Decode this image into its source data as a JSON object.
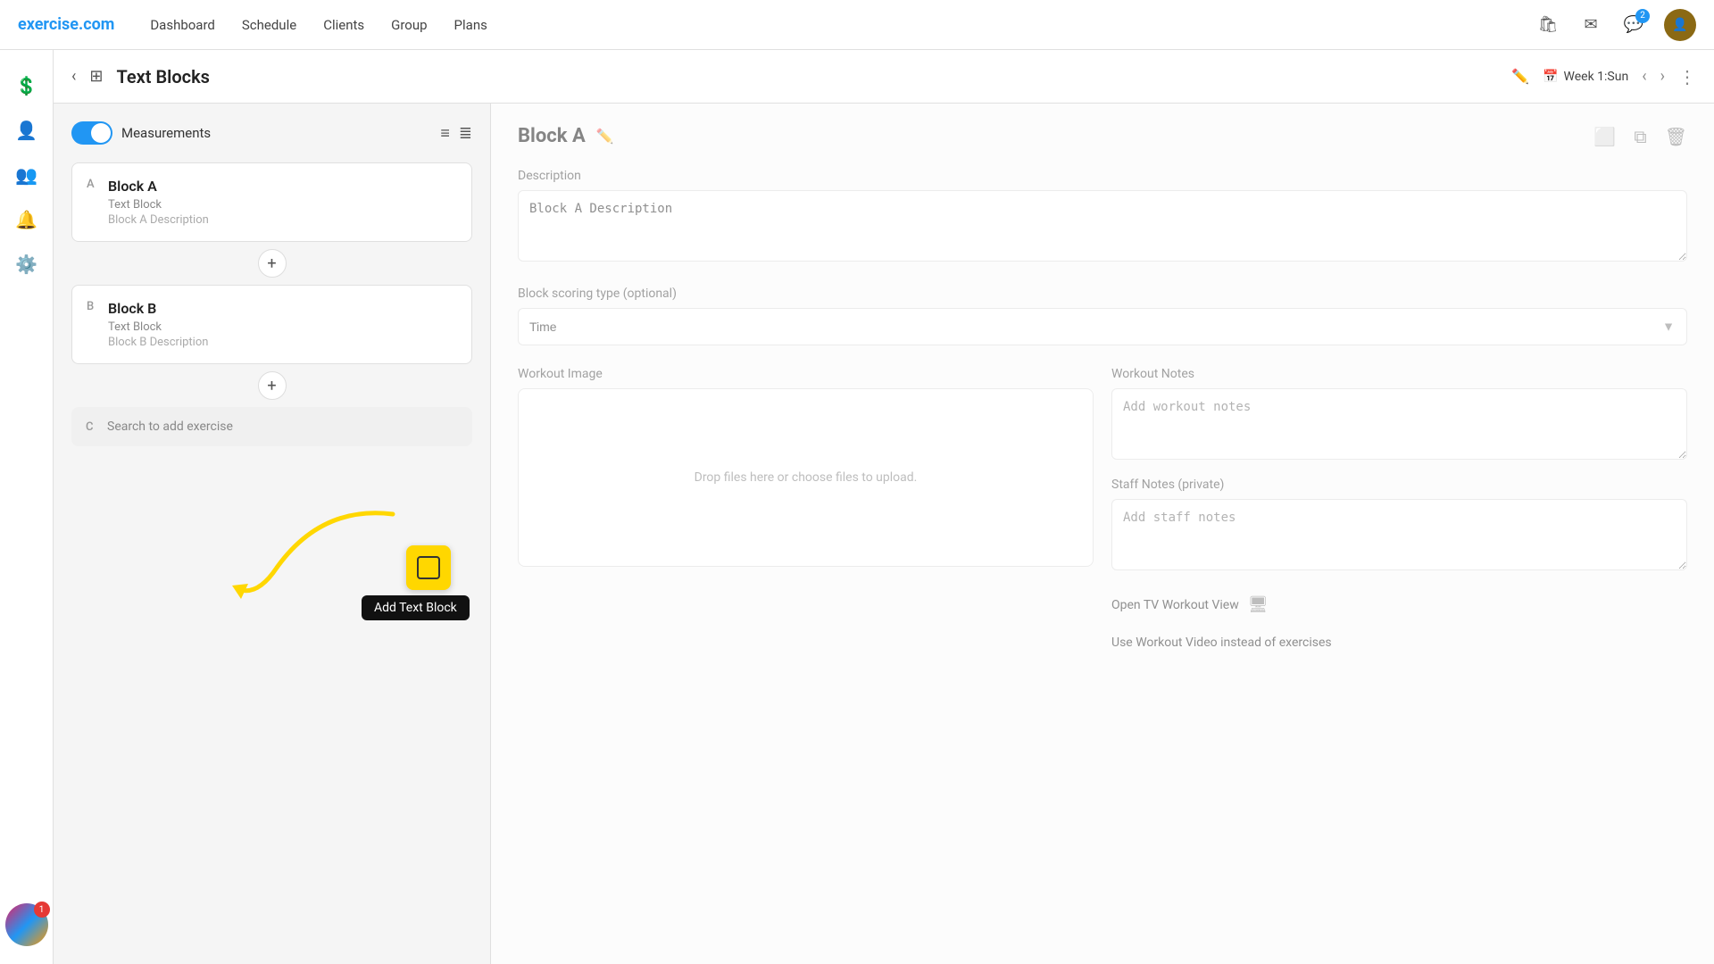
{
  "nav": {
    "logo_text": "exercise",
    "logo_dot": ".com",
    "links": [
      "Dashboard",
      "Schedule",
      "Clients",
      "Group",
      "Plans"
    ],
    "notification_badge": "2"
  },
  "sub_header": {
    "title": "Text Blocks",
    "week_label": "Week 1:Sun"
  },
  "left_panel": {
    "measurements_label": "Measurements",
    "block_a": {
      "letter": "A",
      "name": "Block A",
      "type": "Text Block",
      "description": "Block A Description"
    },
    "block_b": {
      "letter": "B",
      "name": "Block B",
      "type": "Text Block",
      "description": "Block B Description"
    },
    "block_c": {
      "letter": "C",
      "search_placeholder": "Search to add exercise"
    },
    "add_text_block_tooltip": "Add Text Block"
  },
  "right_panel": {
    "block_title": "Block A",
    "description_label": "Description",
    "description_value": "Block A Description",
    "scoring_label": "Block scoring type (optional)",
    "scoring_value": "Time",
    "workout_image_label": "Workout Image",
    "workout_image_drop": "Drop files here or choose files to upload.",
    "workout_notes_label": "Workout Notes",
    "workout_notes_placeholder": "Add workout notes",
    "staff_notes_label": "Staff Notes (private)",
    "staff_notes_placeholder": "Add staff notes",
    "open_tv_label": "Open TV Workout View",
    "use_video_label": "Use Workout Video instead of exercises"
  },
  "sidebar_bottom_badge": "1"
}
